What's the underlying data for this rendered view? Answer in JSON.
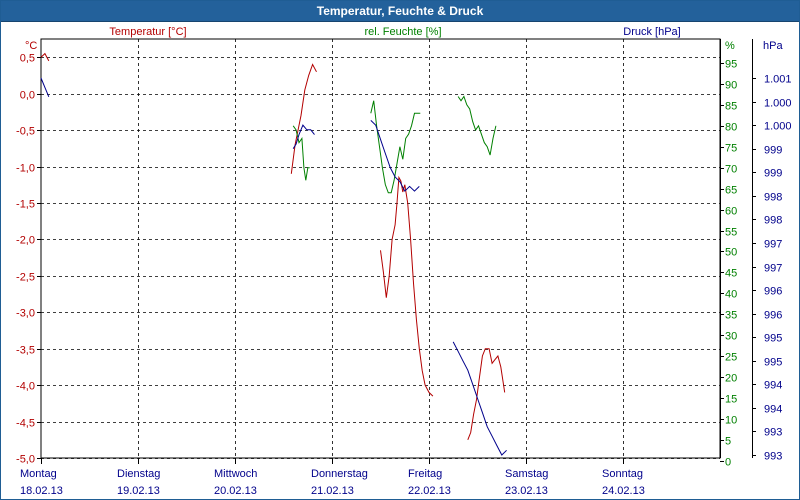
{
  "window": {
    "title": "Temperatur, Feuchte & Druck"
  },
  "colors": {
    "temperature": "#b30000",
    "humidity": "#008000",
    "pressure": "#00008b",
    "frame": "#23619b"
  },
  "chart_data": {
    "type": "line",
    "title": "Temperatur, Feuchte & Druck",
    "grid": true,
    "legend": "top",
    "x_categories": [
      {
        "day": "Montag",
        "date": "18.02.13"
      },
      {
        "day": "Dienstag",
        "date": "19.02.13"
      },
      {
        "day": "Mittwoch",
        "date": "20.02.13"
      },
      {
        "day": "Donnerstag",
        "date": "21.02.13"
      },
      {
        "day": "Freitag",
        "date": "22.02.13"
      },
      {
        "day": "Samstag",
        "date": "23.02.13"
      },
      {
        "day": "Sonntag",
        "date": "24.02.13"
      }
    ],
    "x_range": [
      0,
      7
    ],
    "axes": {
      "temperature": {
        "unit": "°C",
        "label": "Temperatur [°C]",
        "range": [
          -5.0,
          0.75
        ],
        "ticks": [
          "0,5",
          "0,0",
          "-0,5",
          "-1,0",
          "-1,5",
          "-2,0",
          "-2,5",
          "-3,0",
          "-3,5",
          "-4,0",
          "-4,5",
          "-5,0"
        ]
      },
      "humidity": {
        "unit": "%",
        "label": "rel. Feuchte [%]",
        "range": [
          0,
          100
        ],
        "ticks": [
          "95",
          "90",
          "85",
          "80",
          "75",
          "70",
          "65",
          "60",
          "55",
          "50",
          "45",
          "40",
          "35",
          "30",
          "25",
          "20",
          "15",
          "10",
          "5",
          "0"
        ]
      },
      "pressure": {
        "unit": "hPa",
        "label": "Druck [hPa]",
        "ticks": [
          "1.001",
          "1.000",
          "1.000",
          "999",
          "999",
          "998",
          "998",
          "997",
          "997",
          "996",
          "996",
          "995",
          "995",
          "994",
          "994",
          "993",
          "993"
        ]
      }
    },
    "series": [
      {
        "name": "Temperatur [°C]",
        "axis": "temperature",
        "segments": [
          [
            [
              0.0,
              0.5
            ],
            [
              0.04,
              0.55
            ],
            [
              0.08,
              0.45
            ]
          ],
          [
            [
              2.58,
              -1.1
            ],
            [
              2.62,
              -0.7
            ],
            [
              2.68,
              -0.3
            ],
            [
              2.72,
              0.05
            ],
            [
              2.76,
              0.25
            ],
            [
              2.8,
              0.4
            ],
            [
              2.84,
              0.3
            ]
          ],
          [
            [
              3.5,
              -2.15
            ],
            [
              3.53,
              -2.45
            ],
            [
              3.56,
              -2.8
            ],
            [
              3.59,
              -2.5
            ],
            [
              3.62,
              -2.0
            ],
            [
              3.65,
              -1.8
            ],
            [
              3.67,
              -1.5
            ],
            [
              3.69,
              -1.15
            ],
            [
              3.71,
              -1.2
            ],
            [
              3.73,
              -1.35
            ],
            [
              3.75,
              -1.25
            ],
            [
              3.78,
              -1.5
            ],
            [
              3.81,
              -2.0
            ],
            [
              3.84,
              -2.6
            ],
            [
              3.87,
              -3.1
            ],
            [
              3.9,
              -3.5
            ],
            [
              3.93,
              -3.8
            ],
            [
              3.96,
              -4.0
            ],
            [
              4.0,
              -4.1
            ],
            [
              4.04,
              -4.15
            ]
          ],
          [
            [
              4.4,
              -4.75
            ],
            [
              4.43,
              -4.65
            ],
            [
              4.46,
              -4.4
            ],
            [
              4.49,
              -4.2
            ],
            [
              4.52,
              -3.9
            ],
            [
              4.55,
              -3.6
            ],
            [
              4.58,
              -3.5
            ],
            [
              4.62,
              -3.5
            ],
            [
              4.65,
              -3.7
            ],
            [
              4.68,
              -3.65
            ],
            [
              4.71,
              -3.6
            ],
            [
              4.74,
              -3.75
            ],
            [
              4.78,
              -4.1
            ]
          ]
        ]
      },
      {
        "name": "rel. Feuchte [%]",
        "axis": "humidity",
        "segments": [
          [
            [
              2.6,
              80
            ],
            [
              2.63,
              79
            ],
            [
              2.66,
              76
            ],
            [
              2.69,
              77
            ],
            [
              2.71,
              70
            ],
            [
              2.73,
              67
            ],
            [
              2.75,
              70
            ],
            [
              2.77,
              70
            ]
          ],
          [
            [
              3.4,
              83
            ],
            [
              3.43,
              86
            ],
            [
              3.46,
              80
            ],
            [
              3.49,
              75
            ],
            [
              3.52,
              70
            ],
            [
              3.55,
              66
            ],
            [
              3.58,
              64
            ],
            [
              3.61,
              64
            ],
            [
              3.64,
              67
            ],
            [
              3.67,
              71
            ],
            [
              3.7,
              75
            ],
            [
              3.73,
              72
            ],
            [
              3.76,
              77
            ],
            [
              3.79,
              78
            ],
            [
              3.82,
              80
            ],
            [
              3.85,
              83
            ],
            [
              3.88,
              83
            ],
            [
              3.91,
              83
            ]
          ],
          [
            [
              4.3,
              87
            ],
            [
              4.33,
              86
            ],
            [
              4.36,
              87
            ],
            [
              4.39,
              85
            ],
            [
              4.42,
              84
            ],
            [
              4.45,
              81
            ],
            [
              4.48,
              79
            ],
            [
              4.51,
              80
            ],
            [
              4.54,
              78
            ],
            [
              4.57,
              76
            ],
            [
              4.6,
              75
            ],
            [
              4.63,
              73
            ],
            [
              4.66,
              77
            ],
            [
              4.69,
              80
            ]
          ]
        ]
      },
      {
        "name": "Druck [hPa]",
        "axis": "pressure",
        "segments": [
          [
            [
              0.0,
              1001.0
            ],
            [
              0.04,
              1000.8
            ],
            [
              0.08,
              1000.6
            ]
          ],
          [
            [
              2.6,
              999.5
            ],
            [
              2.63,
              999.6
            ],
            [
              2.66,
              999.8
            ],
            [
              2.7,
              1000.0
            ],
            [
              2.74,
              999.9
            ],
            [
              2.78,
              999.9
            ],
            [
              2.82,
              999.8
            ]
          ],
          [
            [
              3.4,
              1000.1
            ],
            [
              3.45,
              1000.0
            ],
            [
              3.5,
              999.7
            ],
            [
              3.55,
              999.4
            ],
            [
              3.6,
              999.1
            ],
            [
              3.65,
              998.9
            ],
            [
              3.7,
              998.8
            ],
            [
              3.75,
              998.6
            ],
            [
              3.8,
              998.7
            ],
            [
              3.85,
              998.6
            ],
            [
              3.9,
              998.7
            ]
          ],
          [
            [
              4.25,
              995.4
            ],
            [
              4.3,
              995.2
            ],
            [
              4.35,
              995.0
            ],
            [
              4.4,
              994.8
            ],
            [
              4.45,
              994.5
            ],
            [
              4.5,
              994.2
            ],
            [
              4.55,
              993.9
            ],
            [
              4.6,
              993.6
            ],
            [
              4.65,
              993.4
            ],
            [
              4.7,
              993.2
            ],
            [
              4.75,
              993.0
            ],
            [
              4.8,
              993.1
            ]
          ]
        ]
      }
    ]
  }
}
